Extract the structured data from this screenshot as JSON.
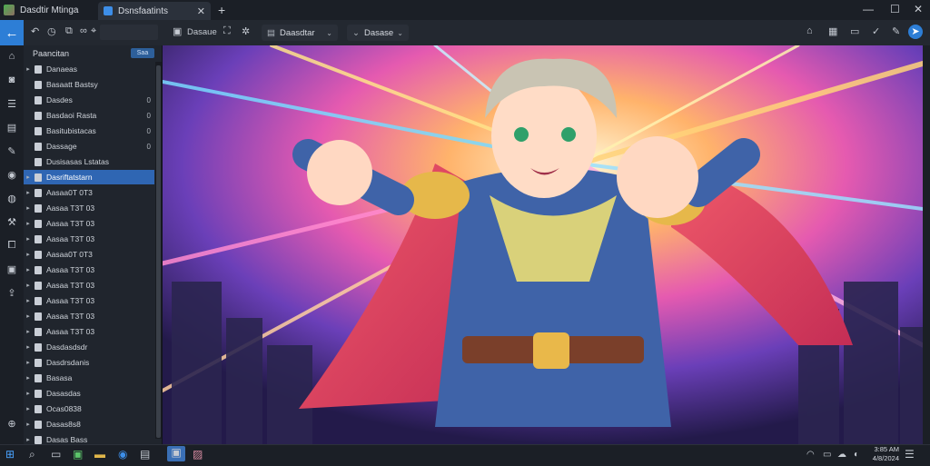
{
  "app": {
    "title": "Dasdtir Mtinga"
  },
  "tab": {
    "label": "Dsnsfaatints",
    "close": "✕",
    "new": "+"
  },
  "window": {
    "minimize": "—",
    "maximize": "☐",
    "close": "✕"
  },
  "toolbar": {
    "back_icon": "←",
    "view_label": "Dasaue",
    "group1": {
      "label": "Daasdtar",
      "chevron": "⌄"
    },
    "group2": {
      "label": "Dasase",
      "chevron": "⌄"
    }
  },
  "panel": {
    "header": "Paancitan",
    "header_button": "Saa"
  },
  "tree": [
    {
      "label": "Danaeas",
      "car": "▸",
      "count": ""
    },
    {
      "label": "Basaatt Bastsy",
      "car": "",
      "count": ""
    },
    {
      "label": "Dasdes",
      "car": "",
      "count": "0"
    },
    {
      "label": "Basdaoi Rasta",
      "car": "",
      "count": "0"
    },
    {
      "label": "Basitubistacas",
      "car": "",
      "count": "0"
    },
    {
      "label": "Dassage",
      "car": "",
      "count": "0"
    },
    {
      "label": "Dusisasas Lstatas",
      "car": "",
      "count": ""
    },
    {
      "label": "Dasriftatstarn",
      "car": "▸",
      "count": ""
    },
    {
      "label": "Aasaa0T 0T3",
      "car": "▸",
      "count": ""
    },
    {
      "label": "Aasaa T3T 03",
      "car": "▸",
      "count": ""
    },
    {
      "label": "Aasaa T3T 03",
      "car": "▸",
      "count": ""
    },
    {
      "label": "Aasaa T3T 03",
      "car": "▸",
      "count": ""
    },
    {
      "label": "Aasaa0T 0T3",
      "car": "▸",
      "count": ""
    },
    {
      "label": "Aasaa T3T 03",
      "car": "▸",
      "count": ""
    },
    {
      "label": "Aasaa T3T 03",
      "car": "▸",
      "count": ""
    },
    {
      "label": "Aasaa T3T 03",
      "car": "▸",
      "count": ""
    },
    {
      "label": "Aasaa T3T 03",
      "car": "▸",
      "count": ""
    },
    {
      "label": "Aasaa T3T 03",
      "car": "▸",
      "count": ""
    },
    {
      "label": "Dasdasdsdr",
      "car": "▸",
      "count": ""
    },
    {
      "label": "Dasdrsdanis",
      "car": "▸",
      "count": ""
    },
    {
      "label": "Basasa",
      "car": "▸",
      "count": ""
    },
    {
      "label": "Dasasdas",
      "car": "▸",
      "count": ""
    },
    {
      "label": "Ocas0838",
      "car": "▸",
      "count": ""
    },
    {
      "label": "Dasas8s8",
      "car": "▸",
      "count": ""
    },
    {
      "label": "Dasas Bass",
      "car": "▸",
      "count": ""
    }
  ],
  "taskbar": {
    "time": "3:85 AM",
    "date": "4/8/2024"
  },
  "colors": {
    "accent": "#2f66b3",
    "back_button": "#2d7ed6",
    "background": "#1e2229"
  }
}
